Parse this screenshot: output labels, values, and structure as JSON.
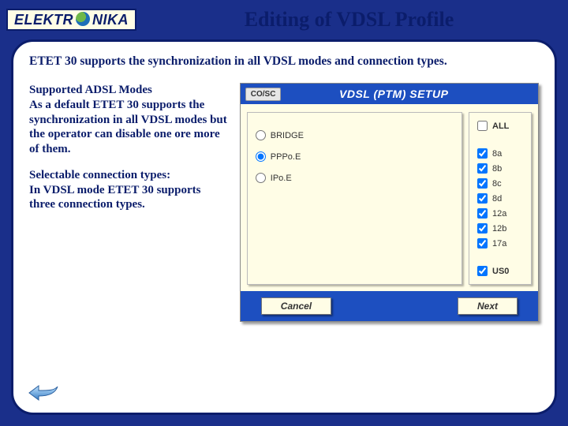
{
  "logo": {
    "left": "ELEKTR",
    "right": "NIKA"
  },
  "title": "Editing of VDSL Profile",
  "lead": "ETET 30 supports the synchronization in all VDSL modes and connection types.",
  "para1_title": "Supported ADSL Modes",
  "para1_body": "As a default ETET 30 supports the synchronization in all VDSL modes but the operator can disable one ore more of them.",
  "para2_title": "Selectable connection types:",
  "para2_body": "In VDSL mode ETET 30 supports three connection types.",
  "device": {
    "tag": "CO/SC",
    "title": "VDSL (PTM) SETUP",
    "connection_types": [
      {
        "label": "BRIDGE",
        "selected": false
      },
      {
        "label": "PPPo.E",
        "selected": true
      },
      {
        "label": "IPo.E",
        "selected": false
      }
    ],
    "mode_all": {
      "label": "ALL",
      "checked": false
    },
    "modes": [
      {
        "label": "8a",
        "checked": true
      },
      {
        "label": "8b",
        "checked": true
      },
      {
        "label": "8c",
        "checked": true
      },
      {
        "label": "8d",
        "checked": true
      },
      {
        "label": "12a",
        "checked": true
      },
      {
        "label": "12b",
        "checked": true
      },
      {
        "label": "17a",
        "checked": true
      }
    ],
    "mode_us0": {
      "label": "US0",
      "checked": true
    },
    "buttons": {
      "cancel": "Cancel",
      "next": "Next"
    }
  },
  "nav": {
    "back": "back-arrow"
  }
}
